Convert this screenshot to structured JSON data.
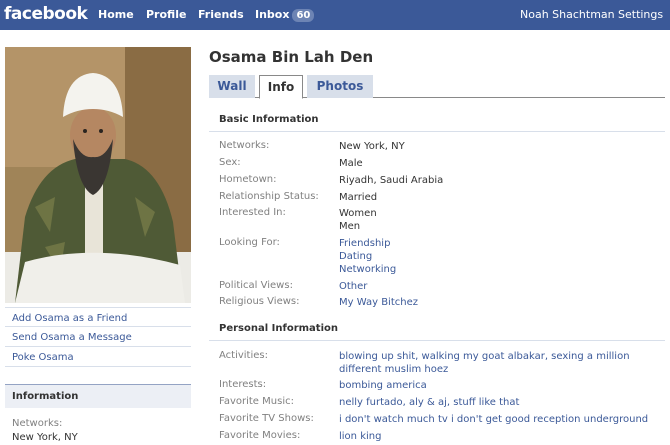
{
  "topbar": {
    "logo": "facebook",
    "nav": {
      "home": "Home",
      "profile": "Profile",
      "friends": "Friends",
      "inbox": "Inbox",
      "inbox_count": "60"
    },
    "user_name": "Noah Shachtman",
    "settings": "Settings"
  },
  "left": {
    "links": [
      "Add Osama as a Friend",
      "Send Osama a Message",
      "Poke Osama"
    ],
    "info_box": {
      "title": "Information",
      "label": "Networks:",
      "value": "New York, NY"
    }
  },
  "profile": {
    "name": "Osama Bin Lah Den",
    "tabs": [
      "Wall",
      "Info",
      "Photos"
    ],
    "active_tab": "Info"
  },
  "basic": {
    "title": "Basic Information",
    "networks": {
      "label": "Networks:",
      "value": "New York, NY"
    },
    "sex": {
      "label": "Sex:",
      "value": "Male"
    },
    "hometown": {
      "label": "Hometown:",
      "value": "Riyadh, Saudi Arabia"
    },
    "relationship": {
      "label": "Relationship Status:",
      "value": "Married"
    },
    "interested_in": {
      "label": "Interested In:",
      "values": [
        "Women",
        "Men"
      ]
    },
    "looking_for": {
      "label": "Looking For:",
      "values": [
        "Friendship",
        "Dating",
        "Networking"
      ]
    },
    "political": {
      "label": "Political Views:",
      "value": "Other"
    },
    "religious": {
      "label": "Religious Views:",
      "value": "My Way Bitchez"
    }
  },
  "personal": {
    "title": "Personal Information",
    "activities": {
      "label": "Activities:",
      "value": "blowing up shit, walking my goat albakar, sexing a million different muslim hoez"
    },
    "interests": {
      "label": "Interests:",
      "value": "bombing america"
    },
    "music": {
      "label": "Favorite Music:",
      "value": "nelly furtado, aly & aj, stuff like that"
    },
    "tv": {
      "label": "Favorite TV Shows:",
      "value": "i don't watch much tv i don't get good reception underground"
    },
    "movies": {
      "label": "Favorite Movies:",
      "value": "lion king"
    }
  },
  "colors": {
    "brand": "#3b5998",
    "tab_bg": "#d8dfea",
    "label": "#808080"
  }
}
